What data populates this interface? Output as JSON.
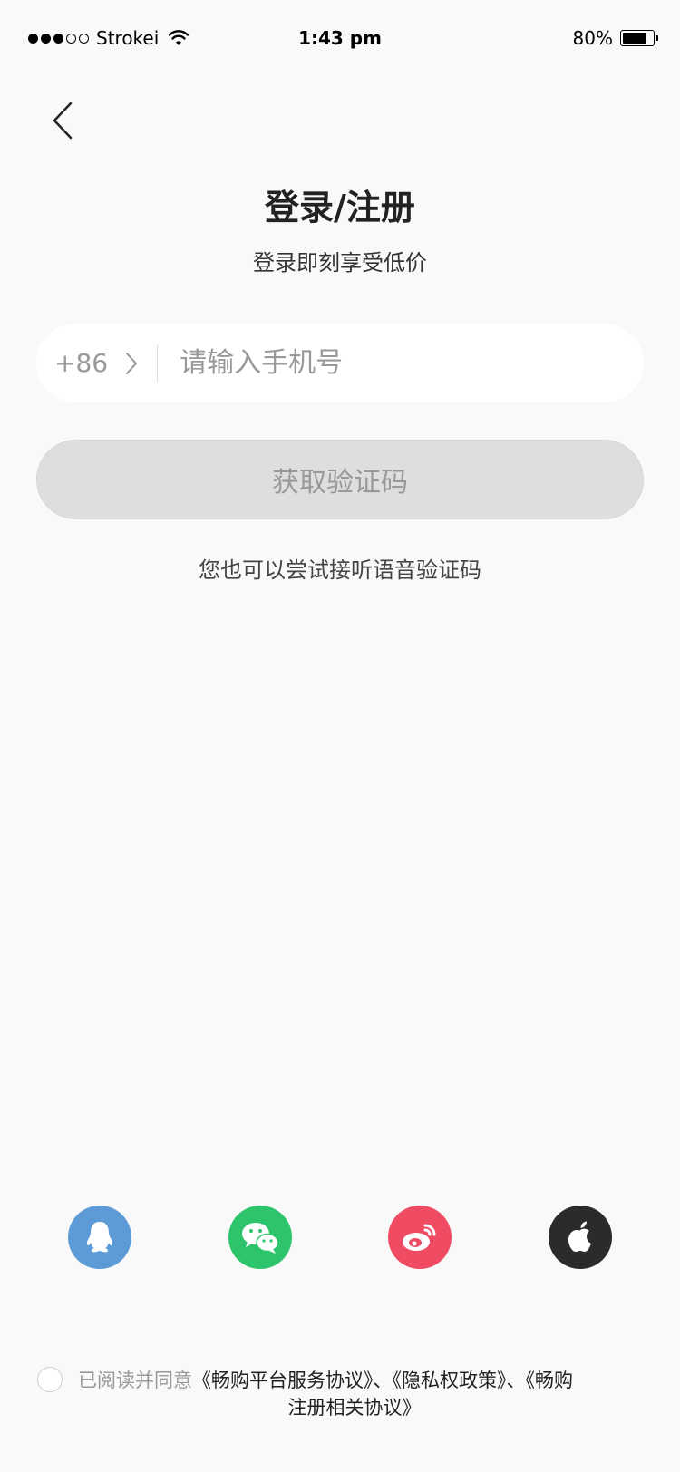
{
  "status_bar": {
    "carrier": "Strokei",
    "time": "1:43 pm",
    "battery": "80%",
    "battery_level": 0.8
  },
  "header": {
    "title": "登录/注册",
    "subtitle": "登录即刻享受低价"
  },
  "phone": {
    "country_code": "+86",
    "placeholder": "请输入手机号",
    "value": ""
  },
  "code_button_label": "获取验证码",
  "voice_hint": "您也可以尝试接听语音验证码",
  "social": [
    {
      "name": "qq",
      "icon": "qq-icon",
      "color": "#5d9bd6"
    },
    {
      "name": "wechat",
      "icon": "wechat-icon",
      "color": "#2ec46c"
    },
    {
      "name": "weibo",
      "icon": "weibo-icon",
      "color": "#ef4c64"
    },
    {
      "name": "apple",
      "icon": "apple-icon",
      "color": "#2b2b2b"
    }
  ],
  "agreement": {
    "prefix": "已阅读并同意",
    "link1": "《畅购平台服务协议》",
    "sep1": "、",
    "link2": "《隐私权政策》",
    "sep2": "、",
    "link3a": "《畅购",
    "link3b": "注册相关协议》"
  }
}
